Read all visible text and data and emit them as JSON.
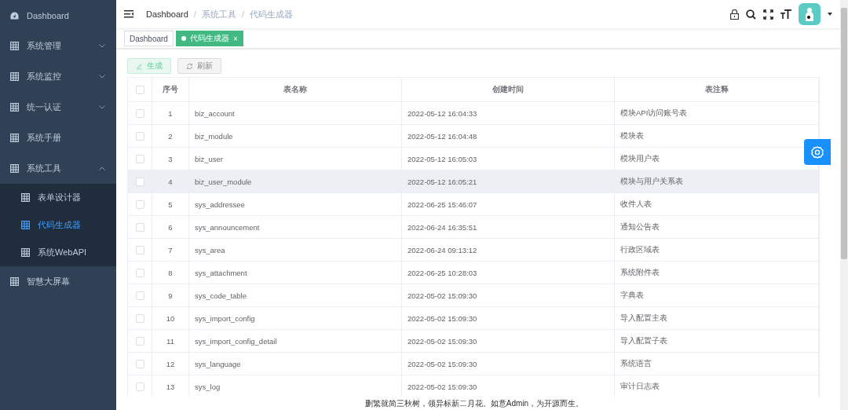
{
  "sidebar": {
    "items": [
      {
        "label": "Dashboard",
        "kind": "dashboard",
        "selected": false
      },
      {
        "label": "系统管理",
        "kind": "grid",
        "expanded": false,
        "selected": false
      },
      {
        "label": "系统监控",
        "kind": "grid",
        "expanded": false,
        "selected": false
      },
      {
        "label": "统一认证",
        "kind": "grid",
        "expanded": false,
        "selected": false
      },
      {
        "label": "系统手册",
        "kind": "grid",
        "selected": false
      },
      {
        "label": "系统工具",
        "kind": "grid",
        "expanded": true,
        "selected": false,
        "children": [
          {
            "label": "表单设计器",
            "kind": "grid",
            "selected": false
          },
          {
            "label": "代码生成器",
            "kind": "grid",
            "selected": true
          },
          {
            "label": "系统WebAPI",
            "kind": "grid",
            "selected": false
          }
        ]
      },
      {
        "label": "智慧大屏幕",
        "kind": "grid",
        "selected": false
      }
    ]
  },
  "breadcrumb": {
    "separator": "/",
    "items": [
      "Dashboard",
      "系统工具",
      "代码生成器"
    ]
  },
  "tabs": [
    {
      "label": "Dashboard",
      "selected": false
    },
    {
      "label": "代码生成器",
      "selected": true,
      "close": "×"
    }
  ],
  "toolbar": {
    "buttons": [
      {
        "label": "生成",
        "kind": "generate"
      },
      {
        "label": "刷新",
        "kind": "refresh"
      }
    ]
  },
  "table": {
    "header_checked": false,
    "columns": [
      "序号",
      "表名称",
      "创建时间",
      "表注释"
    ],
    "rows": [
      {
        "checked": false,
        "highlighted": false,
        "cells": [
          "1",
          "biz_account",
          "2022-05-12 16:04:33",
          "模块API访问账号表"
        ]
      },
      {
        "checked": false,
        "highlighted": false,
        "cells": [
          "2",
          "biz_module",
          "2022-05-12 16:04:48",
          "模块表"
        ]
      },
      {
        "checked": false,
        "highlighted": false,
        "cells": [
          "3",
          "biz_user",
          "2022-05-12 16:05:03",
          "模块用户表"
        ]
      },
      {
        "checked": false,
        "highlighted": true,
        "cells": [
          "4",
          "biz_user_module",
          "2022-05-12 16:05:21",
          "模块与用户关系表"
        ]
      },
      {
        "checked": false,
        "highlighted": false,
        "cells": [
          "5",
          "sys_addressee",
          "2022-06-25 15:46:07",
          "收件人表"
        ]
      },
      {
        "checked": false,
        "highlighted": false,
        "cells": [
          "6",
          "sys_announcement",
          "2022-06-24 16:35:51",
          "通知公告表"
        ]
      },
      {
        "checked": false,
        "highlighted": false,
        "cells": [
          "7",
          "sys_area",
          "2022-06-24 09:13:12",
          "行政区域表"
        ]
      },
      {
        "checked": false,
        "highlighted": false,
        "cells": [
          "8",
          "sys_attachment",
          "2022-06-25 10:28:03",
          "系统附件表"
        ]
      },
      {
        "checked": false,
        "highlighted": false,
        "cells": [
          "9",
          "sys_code_table",
          "2022-05-02 15:09:30",
          "字典表"
        ]
      },
      {
        "checked": false,
        "highlighted": false,
        "cells": [
          "10",
          "sys_import_config",
          "2022-05-02 15:09:30",
          "导入配置主表"
        ]
      },
      {
        "checked": false,
        "highlighted": false,
        "cells": [
          "11",
          "sys_import_config_detail",
          "2022-05-02 15:09:30",
          "导入配置子表"
        ]
      },
      {
        "checked": false,
        "highlighted": false,
        "cells": [
          "12",
          "sys_language",
          "2022-05-02 15:09:30",
          "系统语言"
        ]
      },
      {
        "checked": false,
        "highlighted": false,
        "cells": [
          "13",
          "sys_log",
          "2022-05-02 15:09:30",
          "审计日志表"
        ]
      }
    ]
  },
  "footer": "删繁就简三秋树，领异标新二月花。如意Admin，为开源而生。"
}
